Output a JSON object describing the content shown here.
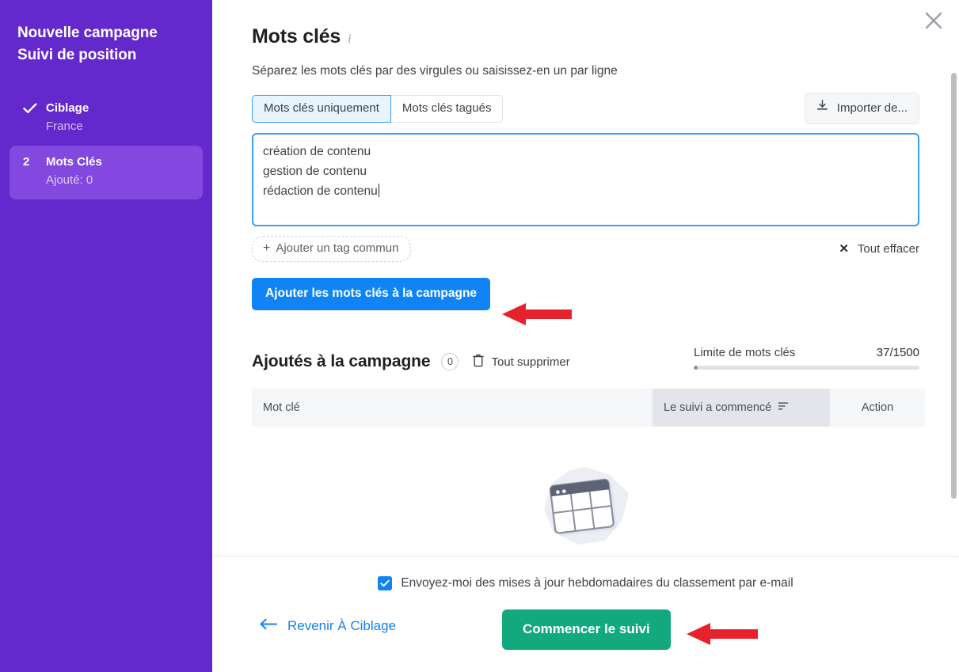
{
  "sidebar": {
    "title_line1": "Nouvelle campagne",
    "title_line2": "Suivi de position",
    "steps": [
      {
        "marker": "check-icon",
        "name": "Ciblage",
        "sub": "France",
        "active": false
      },
      {
        "marker": "2",
        "name": "Mots Clés",
        "sub": "Ajouté: 0",
        "active": true
      }
    ]
  },
  "header": {
    "close_label": "×",
    "title": "Mots clés",
    "info_icon": "i",
    "subtitle": "Séparez les mots clés par des virgules ou saisissez-en un par ligne"
  },
  "tabs": {
    "options": [
      {
        "label": "Mots clés uniquement",
        "selected": true
      },
      {
        "label": "Mots clés taguées",
        "selected": false
      }
    ],
    "selected_label": "Mots clés uniquement",
    "other_label": "Mots clés tagués"
  },
  "import": {
    "label": "Importer de...",
    "icon": "download-icon"
  },
  "keywords_input": {
    "lines": [
      "création de contenu",
      "gestion de contenu",
      "rédaction de contenu"
    ],
    "line1": "création de contenu",
    "line2": "gestion de contenu",
    "line3": "rédaction de contenu",
    "focused": true
  },
  "tag_row": {
    "add_tag_label": "Ajouter un tag commun",
    "add_tag_plus": "+",
    "clear_all_label": "Tout effacer",
    "clear_all_icon": "✕"
  },
  "add_button": {
    "label": "Ajouter les mots clés à la campagne"
  },
  "added_section": {
    "title": "Ajoutés à la campagne",
    "count": "0",
    "delete_all_label": "Tout supprimer",
    "limit_label": "Limite de mots clés",
    "limit_value": "37/1500",
    "limit_percent": 2.5
  },
  "table": {
    "columns": [
      {
        "label": "Mot clé",
        "key": "keyword"
      },
      {
        "label": "Le suivi a commencé",
        "key": "tracking",
        "sorted": true
      },
      {
        "label": "Action",
        "key": "action"
      }
    ],
    "col_keyword": "Mot clé",
    "col_tracking": "Le suivi a commencé",
    "col_action": "Action",
    "rows": []
  },
  "empty_state": {
    "illustration": "empty-table-illustration"
  },
  "footer": {
    "checkbox_checked": true,
    "checkbox_label": "Envoyez-moi des mises à jour hebdomadaires du classement par e-mail",
    "back_label": "Revenir À Ciblage",
    "back_icon": "arrow-left-icon",
    "submit_label": "Commencer le suivi"
  },
  "annotations": {
    "arrow1": "red-arrow-pointing-to-add-keywords-button",
    "arrow2": "red-arrow-pointing-to-start-tracking-button"
  },
  "colors": {
    "sidebar_bg": "#6429CD",
    "sidebar_active": "#8348E0",
    "primary_blue": "#1184f5",
    "green": "#13a97e",
    "arrow_red": "#e8222a",
    "focus_blue": "#3b9cf5"
  }
}
